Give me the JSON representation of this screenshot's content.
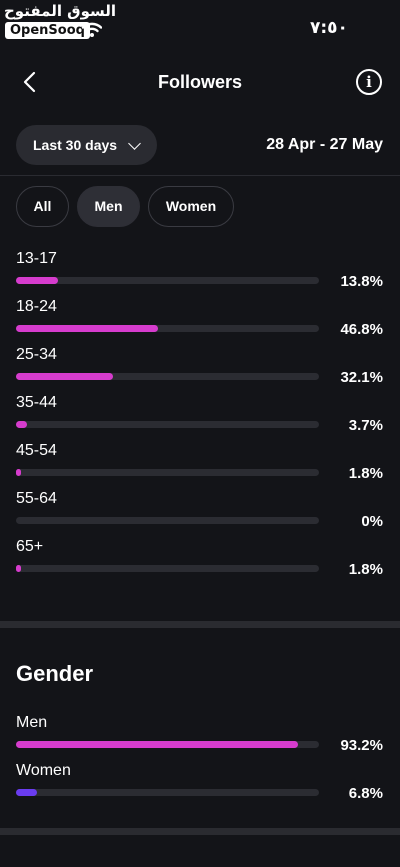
{
  "status_bar": {
    "watermark_ar": "السوق المفتوح",
    "watermark_en": "OpenSooq",
    "time": "٧:٥٠"
  },
  "header": {
    "title": "Followers",
    "back_icon": "chevron-left-icon",
    "info_icon": "info-icon"
  },
  "date_range": {
    "selector_label": "Last 30 days",
    "dates": "28 Apr - 27 May"
  },
  "filters": [
    {
      "label": "All",
      "active": false
    },
    {
      "label": "Men",
      "active": true
    },
    {
      "label": "Women",
      "active": false
    }
  ],
  "age_ranges": [
    {
      "label": "13-17",
      "percent_text": "13.8%",
      "value": 13.8
    },
    {
      "label": "18-24",
      "percent_text": "46.8%",
      "value": 46.8
    },
    {
      "label": "25-34",
      "percent_text": "32.1%",
      "value": 32.1
    },
    {
      "label": "35-44",
      "percent_text": "3.7%",
      "value": 3.7
    },
    {
      "label": "45-54",
      "percent_text": "1.8%",
      "value": 1.8
    },
    {
      "label": "55-64",
      "percent_text": "0%",
      "value": 0
    },
    {
      "label": "65+",
      "percent_text": "1.8%",
      "value": 1.8
    }
  ],
  "gender": {
    "title": "Gender",
    "items": [
      {
        "label": "Men",
        "percent_text": "93.2%",
        "value": 93.2,
        "color": "#d63ccd"
      },
      {
        "label": "Women",
        "percent_text": "6.8%",
        "value": 6.8,
        "color": "#6a3cf0"
      }
    ]
  },
  "colors": {
    "accent": "#d63ccd",
    "women": "#6a3cf0",
    "track": "#2b2c32",
    "background": "#131418"
  }
}
